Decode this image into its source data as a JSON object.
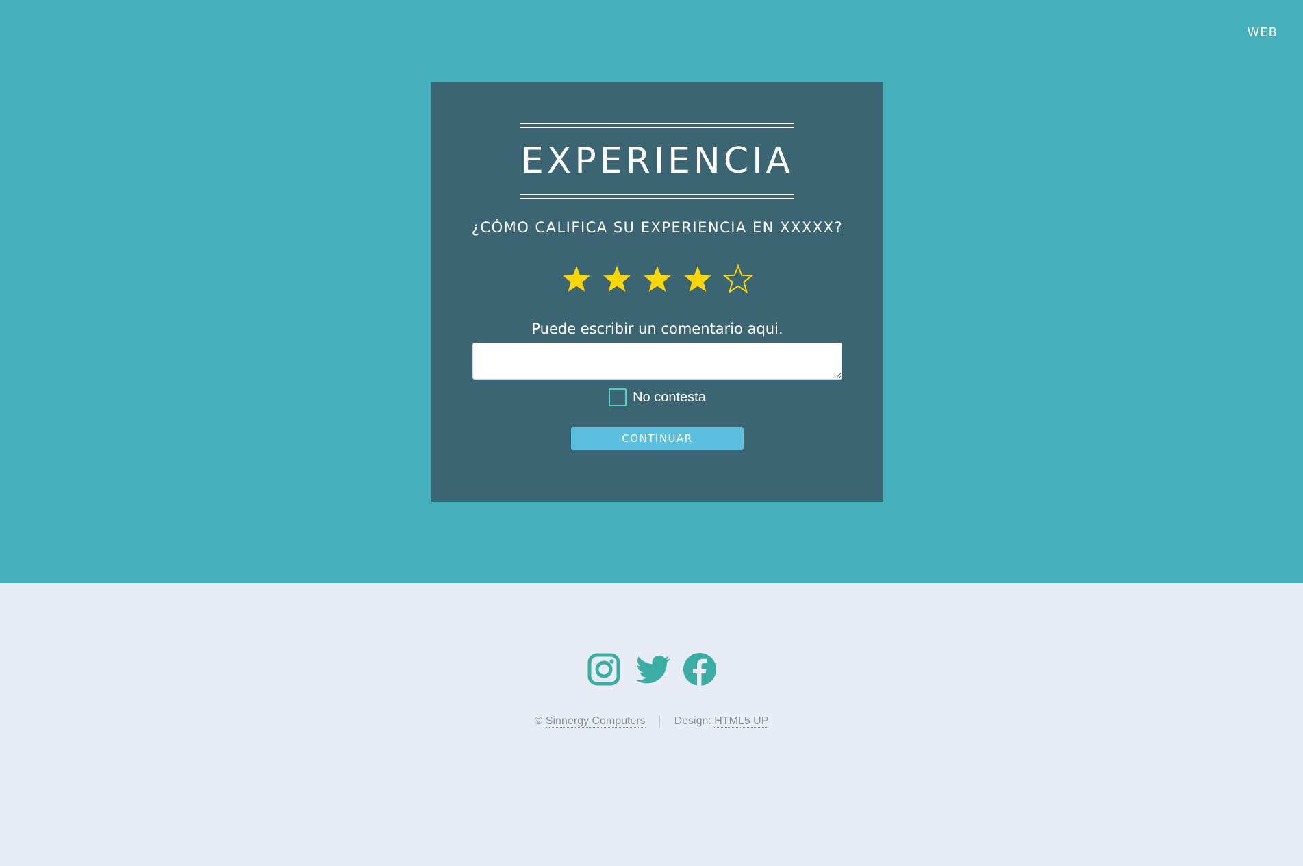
{
  "nav": {
    "web_label": "WEB"
  },
  "card": {
    "title": "EXPERIENCIA",
    "question": "¿CÓMO CALIFICA SU EXPERIENCIA EN XXXXX?",
    "rating": {
      "value": 4,
      "max": 5,
      "filled_color": "#ffd700"
    },
    "comment_label": "Puede escribir un comentario aqui.",
    "comment_value": "",
    "no_answer_label": "No contesta",
    "no_answer_checked": false,
    "continue_label": "CONTINUAR"
  },
  "social": {
    "icons": [
      "instagram-icon",
      "twitter-icon",
      "facebook-icon"
    ],
    "color": "#3aaea4"
  },
  "footer": {
    "copyright_symbol": "©",
    "company_link": "Sinnergy Computers",
    "design_label": "Design:",
    "design_link": "HTML5 UP"
  },
  "colors": {
    "top_background": "#42afbb",
    "card_background": "#3c6573",
    "bottom_background": "#e8edf5",
    "button": "#5bbfe0"
  }
}
